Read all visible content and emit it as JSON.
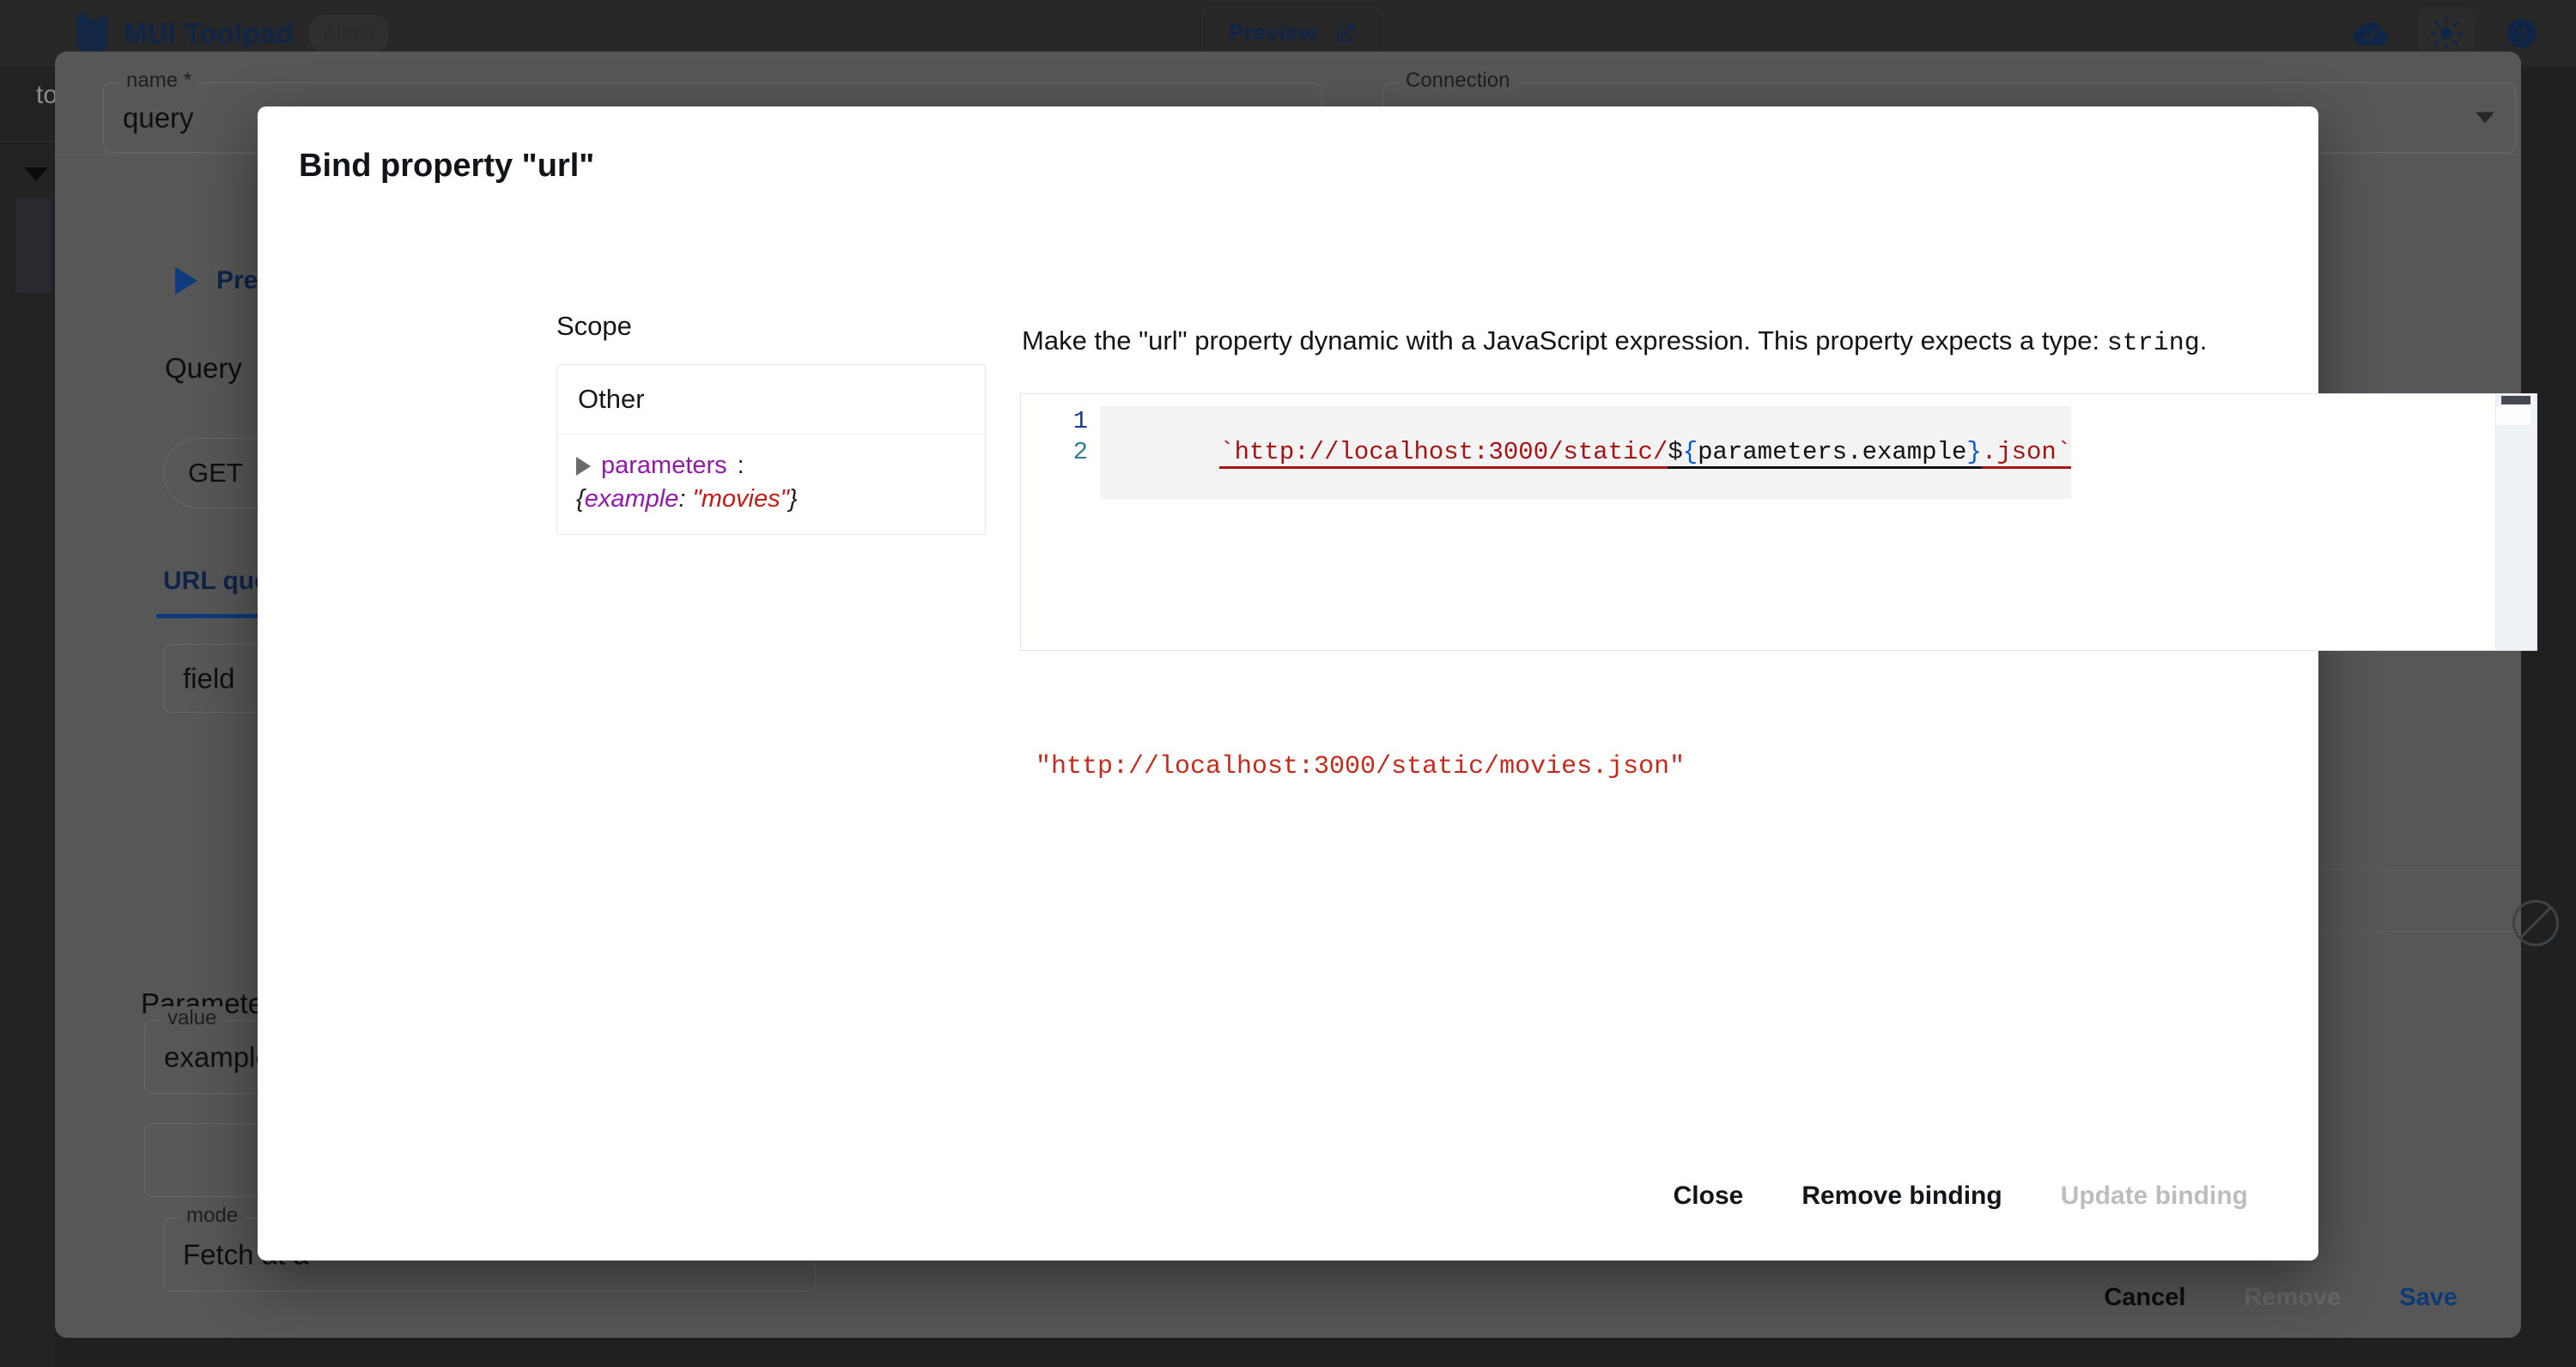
{
  "appbar": {
    "brand_title": "MUI Toolpad",
    "alpha_badge": "Alpha",
    "preview_label": "Preview",
    "icons": {
      "open_in_new": "open-in-new-icon",
      "cloud_done": "cloud-done-icon",
      "brightness": "brightness-icon",
      "help": "help-icon"
    }
  },
  "left_rail": {
    "truncated_label": "to"
  },
  "query_panel": {
    "name_field": {
      "label": "name *",
      "value": "query"
    },
    "connection_field": {
      "label": "Connection",
      "value": ""
    },
    "preview_run_label": "Preview",
    "query_heading": "Query",
    "method_select": {
      "value": "GET"
    },
    "url_tab_label": "URL query",
    "query_field": {
      "label": "",
      "value": "field"
    },
    "parameters_heading": "Parameters",
    "value_field": {
      "label": "value",
      "value": "example"
    },
    "blank_field": {
      "label": "",
      "value": ""
    },
    "mode_field": {
      "label": "mode",
      "value": "Fetch at a"
    },
    "footer": {
      "cancel": "Cancel",
      "remove": "Remove",
      "save": "Save"
    }
  },
  "dialog": {
    "title": "Bind property \"url\"",
    "scope": {
      "label": "Scope",
      "other_label": "Other",
      "tree": {
        "key": "parameters",
        "colon": ":",
        "value_open": "{",
        "value_prop": "example",
        "value_colon": ": ",
        "value_str": "\"movies\"",
        "value_close": "}"
      }
    },
    "description": {
      "text_before": "Make the \"url\" property dynamic with a JavaScript expression. This property expects a type: ",
      "type_mono": "string",
      "text_after": "."
    },
    "editor": {
      "line_numbers": [
        "1",
        "2"
      ],
      "code_segments": [
        {
          "text": "`",
          "token": "template"
        },
        {
          "text": "http://localhost:3000/static/",
          "token": "template"
        },
        {
          "text": "$",
          "token": "dollar"
        },
        {
          "text": "{",
          "token": "brace"
        },
        {
          "text": "parameters.example",
          "token": "ident"
        },
        {
          "text": "}",
          "token": "brace"
        },
        {
          "text": ".json",
          "token": "template"
        },
        {
          "text": "`",
          "token": "template"
        }
      ],
      "full_code": "`http://localhost:3000/static/${parameters.example}.json`"
    },
    "result_preview": "\"http://localhost:3000/static/movies.json\"",
    "actions": [
      {
        "label": "Close",
        "enabled": true
      },
      {
        "label": "Remove binding",
        "enabled": true
      },
      {
        "label": "Update binding",
        "enabled": false
      }
    ]
  },
  "colors": {
    "brand_blue": "#16376b",
    "accent_blue": "#1457b8",
    "error_red": "#c42b1c",
    "token_purple": "#8f1ba8",
    "token_string_red": "#c41a16",
    "disabled_grey": "#bdbdbd"
  }
}
